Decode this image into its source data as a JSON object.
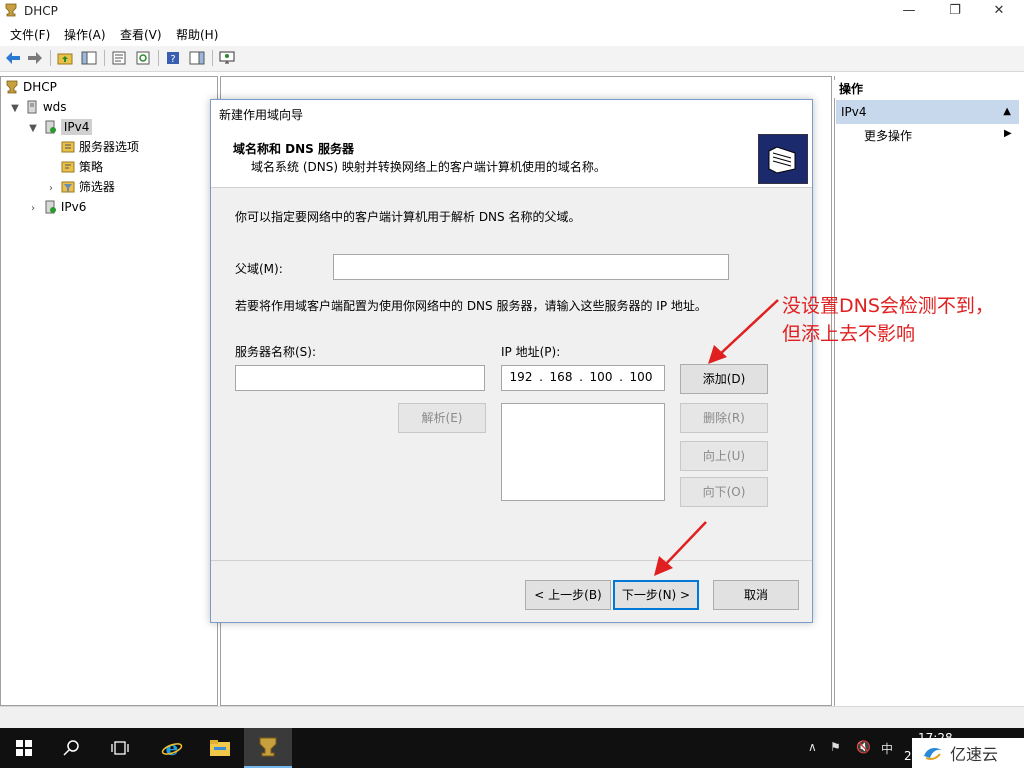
{
  "window": {
    "title": "DHCP",
    "controls": {
      "minimize": "—",
      "maximize": "❐",
      "close": "✕"
    }
  },
  "menu": [
    "文件(F)",
    "操作(A)",
    "查看(V)",
    "帮助(H)"
  ],
  "tree": {
    "root": "DHCP",
    "server": "wds",
    "ipv4": "IPv4",
    "ipv4_children": [
      "服务器选项",
      "策略",
      "筛选器"
    ],
    "ipv6": "IPv6"
  },
  "actions": {
    "header": "操作",
    "group": "IPv4",
    "more": "更多操作"
  },
  "dialog": {
    "title": "新建作用域向导",
    "header_title": "域名称和 DNS 服务器",
    "header_subtitle": "域名系统 (DNS) 映射并转换网络上的客户端计算机使用的域名称。",
    "intro": "你可以指定要网络中的客户端计算机用于解析 DNS 名称的父域。",
    "parent_domain_label": "父域(M):",
    "parent_domain_value": "",
    "dns_instruction": "若要将作用域客户端配置为使用你网络中的 DNS 服务器，请输入这些服务器的 IP 地址。",
    "server_name_label": "服务器名称(S):",
    "server_name_value": "",
    "ip_label": "IP 地址(P):",
    "ip": [
      "192",
      "168",
      "100",
      "100"
    ],
    "buttons": {
      "resolve": "解析(E)",
      "add": "添加(D)",
      "remove": "删除(R)",
      "up": "向上(U)",
      "down": "向下(O)",
      "back": "< 上一步(B)",
      "next": "下一步(N) >",
      "cancel": "取消"
    }
  },
  "annotation": {
    "line1": "没设置DNS会检测不到，",
    "line2": "但添上去不影响",
    "color": "#e02020"
  },
  "taskbar": {
    "ime": "中",
    "time": "17:28",
    "date_partial": "20"
  },
  "watermark": "亿速云",
  "colors": {
    "selection": "#c8d8ec",
    "accent": "#0078d7",
    "taskbar": "#101010"
  }
}
